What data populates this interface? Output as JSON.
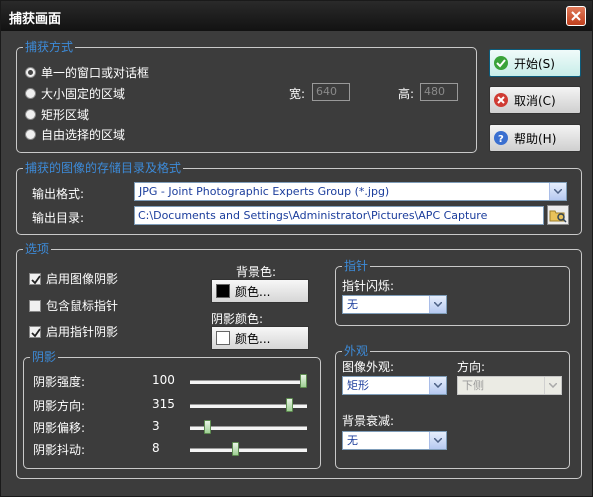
{
  "window": {
    "title": "捕获画面"
  },
  "capture_mode": {
    "legend": "捕获方式",
    "options": [
      "单一的窗口或对话框",
      "大小固定的区域",
      "矩形区域",
      "自由选择的区域"
    ],
    "selected_index": 0,
    "width_label": "宽:",
    "width_value": "640",
    "height_label": "高:",
    "height_value": "480"
  },
  "buttons": {
    "start": "开始(S)",
    "cancel": "取消(C)",
    "help": "帮助(H)"
  },
  "storage": {
    "legend": "捕获的图像的存储目录及格式",
    "format_label": "输出格式:",
    "format_value": "JPG - Joint Photographic Experts Group (*.jpg)",
    "dir_label": "输出目录:",
    "dir_value": "C:\\Documents and Settings\\Administrator\\Pictures\\APC Capture"
  },
  "options": {
    "legend": "选项",
    "checkboxes": [
      {
        "label": "启用图像阴影",
        "checked": true
      },
      {
        "label": "包含鼠标指针",
        "checked": false
      },
      {
        "label": "启用指针阴影",
        "checked": true
      }
    ],
    "bg_color_label": "背景色:",
    "bg_color_button": "颜色...",
    "bg_color": "#000000",
    "shadow_color_label": "阴影颜色:",
    "shadow_color_button": "颜色...",
    "shadow_color": "#ffffff"
  },
  "shadow": {
    "legend": "阴影",
    "rows": [
      {
        "label": "阴影强度:",
        "value": "100",
        "level": 1.0
      },
      {
        "label": "阴影方向:",
        "value": "315",
        "level": 0.875
      },
      {
        "label": "阴影偏移:",
        "value": "3",
        "level": 0.15
      },
      {
        "label": "阴影抖动:",
        "value": "8",
        "level": 0.4
      }
    ]
  },
  "pointer": {
    "legend": "指针",
    "flash_label": "指针闪烁:",
    "flash_value": "无"
  },
  "appearance": {
    "legend": "外观",
    "image_look_label": "图像外观:",
    "image_look_value": "矩形",
    "direction_label": "方向:",
    "direction_value": "下侧",
    "bg_fade_label": "背景衰减:",
    "bg_fade_value": "无"
  },
  "colors": {
    "accent": "#3d8bd9",
    "window_bg": "#3c3c3c",
    "titlebar": "#1c1c1c",
    "close": "#d2522f"
  }
}
